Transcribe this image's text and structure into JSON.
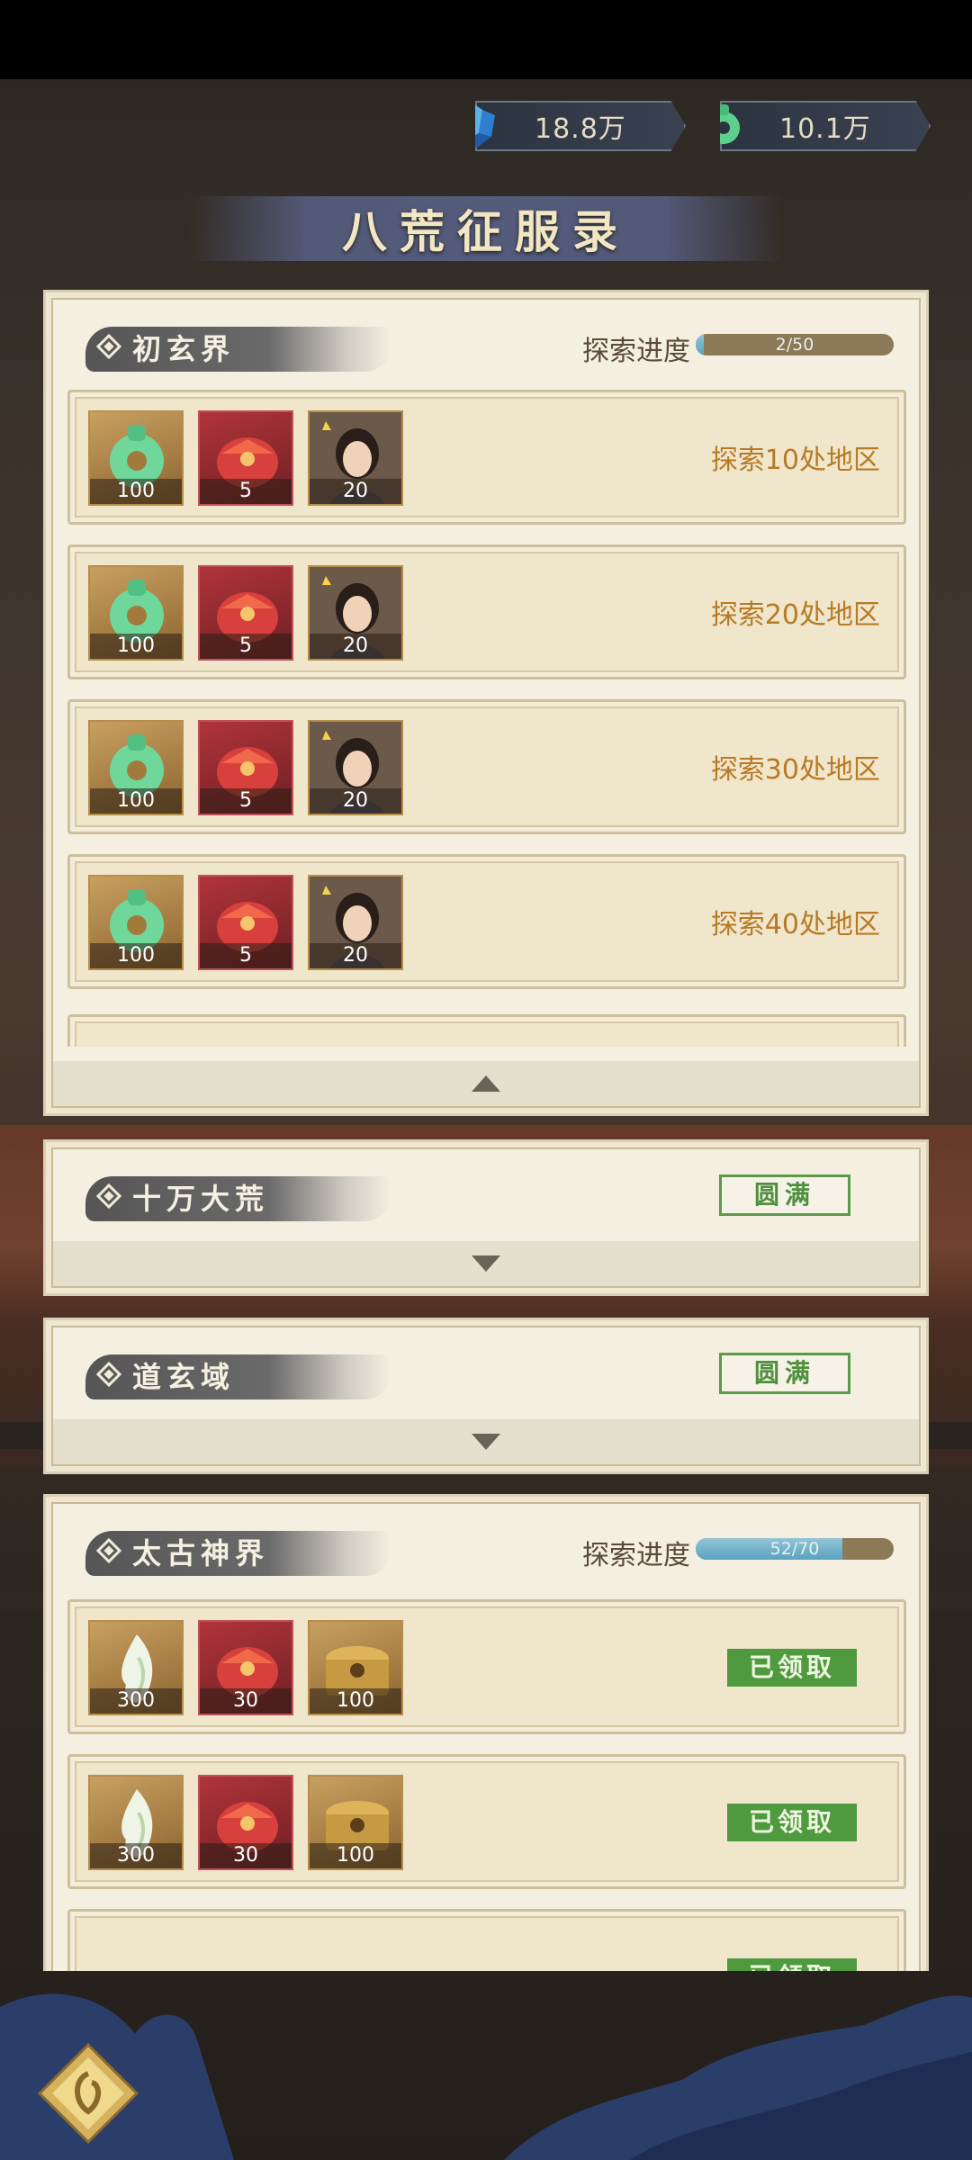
{
  "currencies": [
    {
      "icon": "blue-crystal-icon",
      "value": "18.8万"
    },
    {
      "icon": "jade-pendant-icon",
      "value": "10.1万"
    }
  ],
  "title": "八荒征服录",
  "progress_label": "探索进度",
  "panels": [
    {
      "name": "初玄界",
      "progress_text": "2/50",
      "progress_fraction": 0.04,
      "rows": [
        {
          "rewards": [
            {
              "icon": "jade-pendant-icon",
              "qty": "100"
            },
            {
              "icon": "red-gift-pouch-icon",
              "qty": "5"
            },
            {
              "icon": "heroine-portrait-icon",
              "qty": "20"
            }
          ],
          "requirement": "探索10处地区"
        },
        {
          "rewards": [
            {
              "icon": "jade-pendant-icon",
              "qty": "100"
            },
            {
              "icon": "red-gift-pouch-icon",
              "qty": "5"
            },
            {
              "icon": "heroine-portrait-icon",
              "qty": "20"
            }
          ],
          "requirement": "探索20处地区"
        },
        {
          "rewards": [
            {
              "icon": "jade-pendant-icon",
              "qty": "100"
            },
            {
              "icon": "red-gift-pouch-icon",
              "qty": "5"
            },
            {
              "icon": "heroine-portrait-icon",
              "qty": "20"
            }
          ],
          "requirement": "探索30处地区"
        },
        {
          "rewards": [
            {
              "icon": "jade-pendant-icon",
              "qty": "100"
            },
            {
              "icon": "red-gift-pouch-icon",
              "qty": "5"
            },
            {
              "icon": "heroine-portrait-icon",
              "qty": "20"
            }
          ],
          "requirement": "探索40处地区"
        }
      ]
    },
    {
      "name": "十万大荒",
      "status": "圆满"
    },
    {
      "name": "道玄域",
      "status": "圆满"
    },
    {
      "name": "太古神界",
      "progress_text": "52/70",
      "progress_fraction": 0.743,
      "rows": [
        {
          "rewards": [
            {
              "icon": "white-flame-icon",
              "qty": "300"
            },
            {
              "icon": "red-gift-pouch-icon",
              "qty": "30"
            },
            {
              "icon": "gold-chest-icon",
              "qty": "100"
            }
          ],
          "status": "已领取"
        },
        {
          "rewards": [
            {
              "icon": "white-flame-icon",
              "qty": "300"
            },
            {
              "icon": "red-gift-pouch-icon",
              "qty": "30"
            },
            {
              "icon": "gold-chest-icon",
              "qty": "100"
            }
          ],
          "status": "已领取"
        }
      ]
    }
  ],
  "colors": {
    "accent_gold": "#b87a24",
    "claimed_green": "#4f9a3e",
    "progress_blue": "#5aa2bf"
  }
}
